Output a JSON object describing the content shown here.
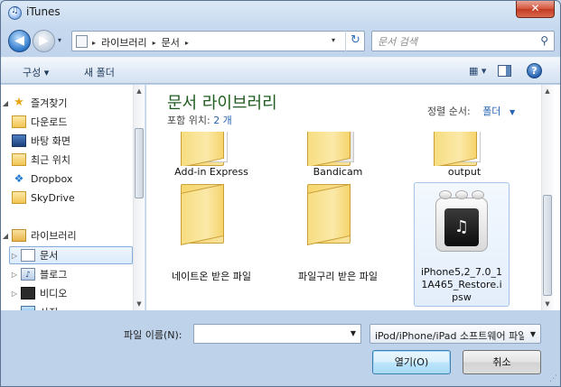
{
  "window": {
    "title": "iTunes",
    "close_label": "✕"
  },
  "nav": {
    "back_label": "◀",
    "forward_label": "▶",
    "history_label": "▾",
    "breadcrumbs": [
      "라이브러리",
      "문서"
    ],
    "crumb_sep": "▸",
    "address_dropdown": "▾",
    "refresh_label": "↻"
  },
  "search": {
    "placeholder": "문서 검색",
    "icon": "search-icon"
  },
  "toolbar": {
    "organize_label": "구성 ▾",
    "new_folder_label": "새 폴더",
    "views_label": "▦ ▾",
    "help_label": "?"
  },
  "sidebar": {
    "items": [
      {
        "label": "즐겨찾기",
        "icon": "star-icon",
        "expand": "◢"
      },
      {
        "label": "다운로드",
        "icon": "downloads-folder-icon"
      },
      {
        "label": "바탕 화면",
        "icon": "desktop-icon"
      },
      {
        "label": "최근 위치",
        "icon": "recent-places-icon"
      },
      {
        "label": "Dropbox",
        "icon": "dropbox-icon"
      },
      {
        "label": "SkyDrive",
        "icon": "skydrive-folder-icon"
      },
      {
        "label": "라이브러리",
        "icon": "libraries-icon",
        "expand": "◢"
      },
      {
        "label": "문서",
        "icon": "documents-icon",
        "expand": "▷",
        "selected": true
      },
      {
        "label": "블로그",
        "icon": "library-icon",
        "expand": "▷"
      },
      {
        "label": "비디오",
        "icon": "video-icon",
        "expand": "▷"
      },
      {
        "label": "사진",
        "icon": "pictures-icon",
        "expand": "▷"
      }
    ]
  },
  "main": {
    "library_title": "문서 라이브러리",
    "includes_label": "포함 위치:",
    "includes_count": "2 개",
    "arrange_label": "정렬 순서:",
    "arrange_value": "폴더",
    "arrange_arrow": "▼",
    "files": [
      {
        "name": "Add-in Express",
        "type": "folder"
      },
      {
        "name": "Bandicam",
        "type": "folder"
      },
      {
        "name": "output",
        "type": "folder"
      },
      {
        "name": "네이트온 받은 파일",
        "type": "folder"
      },
      {
        "name": "파일구리 받은 파일",
        "type": "folder"
      },
      {
        "name": "iPhone5,2_7.0_11A465_Restore.ipsw",
        "type": "ipsw",
        "selected": true
      }
    ]
  },
  "footer": {
    "filename_label": "파일 이름(N):",
    "filename_value": "",
    "filter_value": "iPod/iPhone/iPad 소프트웨어 파일 (*.ipsw)",
    "open_label": "열기(O)",
    "cancel_label": "취소"
  }
}
